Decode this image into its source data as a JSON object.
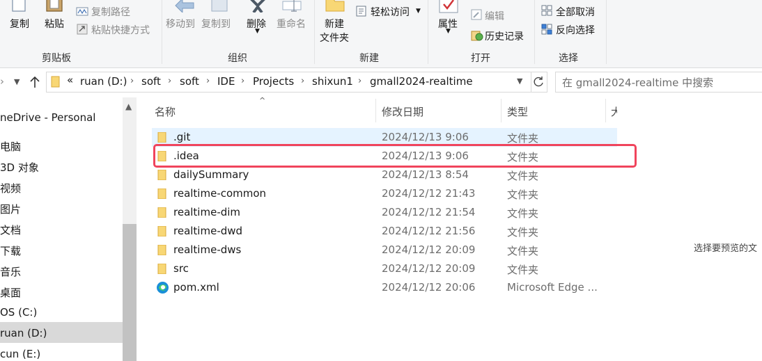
{
  "ribbon": {
    "clipboard": {
      "copy": "复制",
      "paste": "粘贴",
      "copy_path": "复制路径",
      "paste_shortcut": "粘贴快捷方式",
      "label": "剪贴板"
    },
    "organize": {
      "move_to": "移动到",
      "copy_to": "复制到",
      "delete": "删除",
      "rename": "重命名",
      "label": "组织"
    },
    "new": {
      "new_folder_line1": "新建",
      "new_folder_line2": "文件夹",
      "easy_access": "轻松访问",
      "label": "新建"
    },
    "open": {
      "properties": "属性",
      "edit": "编辑",
      "history": "历史记录",
      "label": "打开"
    },
    "select": {
      "select_all": "全部取消",
      "invert": "反向选择",
      "label": "选择"
    }
  },
  "address": {
    "prefix": "«",
    "crumbs": [
      "ruan (D:)",
      "soft",
      "soft",
      "IDE",
      "Projects",
      "shixun1",
      "gmall2024-realtime"
    ],
    "search_placeholder": "在 gmall2024-realtime 中搜索"
  },
  "nav": {
    "items": [
      "neDrive - Personal",
      "电脑",
      "3D 对象",
      "视频",
      "图片",
      "文档",
      "下载",
      "音乐",
      "桌面",
      "OS (C:)",
      "ruan (D:)",
      "cun (E:)"
    ],
    "selected_index": 10
  },
  "columns": {
    "name": "名称",
    "date": "修改日期",
    "type": "类型",
    "size": "大"
  },
  "files": [
    {
      "name": ".git",
      "date": "2024/12/13 9:06",
      "type": "文件夹",
      "icon": "folder-icon"
    },
    {
      "name": ".idea",
      "date": "2024/12/13 9:06",
      "type": "文件夹",
      "icon": "folder-icon"
    },
    {
      "name": "dailySummary",
      "date": "2024/12/13 8:54",
      "type": "文件夹",
      "icon": "folder-icon"
    },
    {
      "name": "realtime-common",
      "date": "2024/12/12 21:43",
      "type": "文件夹",
      "icon": "folder-icon"
    },
    {
      "name": "realtime-dim",
      "date": "2024/12/12 21:54",
      "type": "文件夹",
      "icon": "folder-icon"
    },
    {
      "name": "realtime-dwd",
      "date": "2024/12/12 21:56",
      "type": "文件夹",
      "icon": "folder-icon"
    },
    {
      "name": "realtime-dws",
      "date": "2024/12/12 20:09",
      "type": "文件夹",
      "icon": "folder-icon"
    },
    {
      "name": "src",
      "date": "2024/12/12 20:09",
      "type": "文件夹",
      "icon": "folder-icon"
    },
    {
      "name": "pom.xml",
      "date": "2024/12/12 20:06",
      "type": "Microsoft Edge ...",
      "icon": "edge-icon"
    }
  ],
  "preview_text": "选择要预览的文",
  "colors": {
    "accent": "#0078d4",
    "folder": "#f8d775",
    "highlight": "#f0445c",
    "selected_row": "#e5f3ff"
  }
}
